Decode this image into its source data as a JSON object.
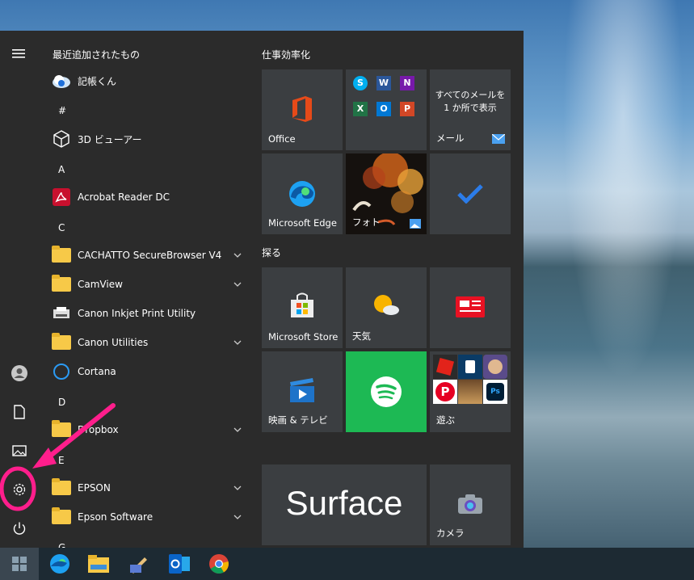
{
  "applist": {
    "recent_title": "最近追加されたもの",
    "items": [
      {
        "label": "記帳くん",
        "icon": "kichou-app-icon"
      },
      {
        "letter": "#"
      },
      {
        "label": "3D ビューアー",
        "icon": "3d-viewer-icon"
      },
      {
        "letter": "A"
      },
      {
        "label": "Acrobat Reader DC",
        "icon": "acrobat-icon"
      },
      {
        "letter": "C"
      },
      {
        "label": "CACHATTO SecureBrowser V4",
        "icon": "folder-icon",
        "expand": true
      },
      {
        "label": "CamView",
        "icon": "folder-icon",
        "expand": true
      },
      {
        "label": "Canon Inkjet Print Utility",
        "icon": "canon-print-icon"
      },
      {
        "label": "Canon Utilities",
        "icon": "folder-icon",
        "expand": true
      },
      {
        "label": "Cortana",
        "icon": "cortana-icon"
      },
      {
        "letter": "D"
      },
      {
        "label": "Dropbox",
        "icon": "folder-icon",
        "expand": true
      },
      {
        "letter": "E"
      },
      {
        "label": "EPSON",
        "icon": "folder-icon",
        "expand": true
      },
      {
        "label": "Epson Software",
        "icon": "folder-icon",
        "expand": true
      },
      {
        "letter": "G"
      }
    ]
  },
  "tiles": {
    "group1": "仕事効率化",
    "group2": "探る",
    "office": "Office",
    "mail_text": "すべてのメールを 1 か所で表示",
    "mail": "メール",
    "edge": "Microsoft Edge",
    "photos": "フォト",
    "store": "Microsoft Store",
    "weather": "天気",
    "movies": "映画 & テレビ",
    "play": "遊ぶ",
    "surface": "Surface",
    "camera": "カメラ"
  },
  "colors": {
    "accent": "#ff1e8c",
    "spotify": "#1db954",
    "office": "#e64a19"
  }
}
